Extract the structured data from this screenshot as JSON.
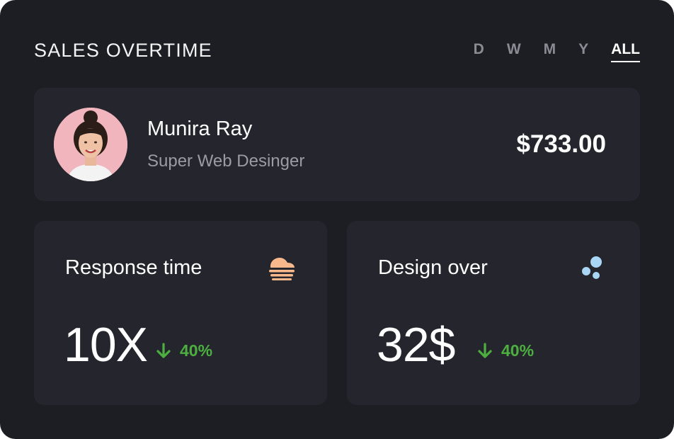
{
  "header": {
    "title": "SALES OVERTIME",
    "filters": [
      "D",
      "W",
      "M",
      "Y",
      "ALL"
    ],
    "active_filter": "ALL"
  },
  "profile": {
    "name": "Munira Ray",
    "role": "Super Web Desinger",
    "amount": "$733.00"
  },
  "stats": [
    {
      "label": "Response time",
      "value": "10X",
      "trend": "40%",
      "trend_direction": "down",
      "icon": "fog-icon",
      "icon_color": "#f7b98c"
    },
    {
      "label": "Design over",
      "value": "32$",
      "trend": "40%",
      "trend_direction": "down",
      "icon": "bubbles-icon",
      "icon_color": "#a9d6f5"
    }
  ],
  "colors": {
    "background": "#1d1e24",
    "panel": "#25262d",
    "trend": "#4caf3f",
    "muted": "#9a9ca4"
  }
}
